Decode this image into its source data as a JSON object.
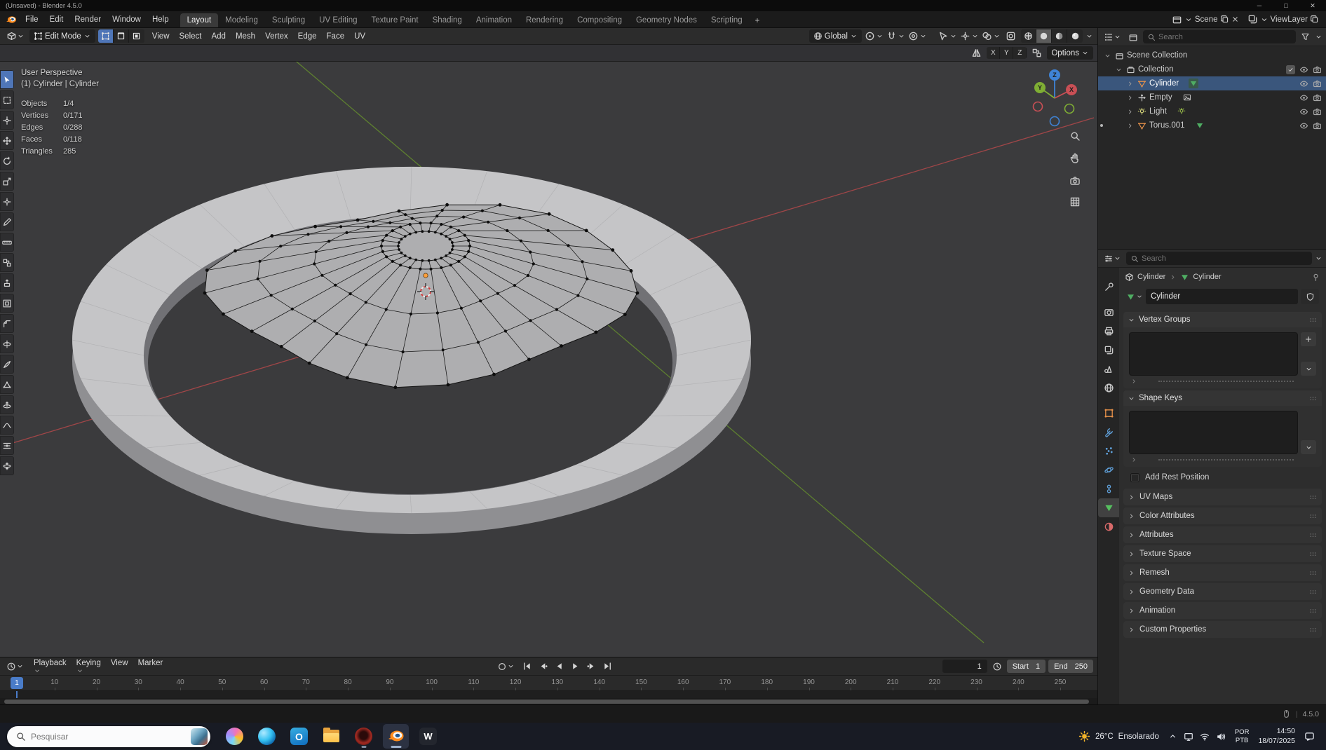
{
  "window": {
    "title": "(Unsaved) - Blender 4.5.0"
  },
  "topbar": {
    "menus": [
      "File",
      "Edit",
      "Render",
      "Window",
      "Help"
    ],
    "workspaces": [
      "Layout",
      "Modeling",
      "Sculpting",
      "UV Editing",
      "Texture Paint",
      "Shading",
      "Animation",
      "Rendering",
      "Compositing",
      "Geometry Nodes",
      "Scripting"
    ],
    "active_workspace": "Layout",
    "add_tab": "+",
    "scene_label": "Scene",
    "viewlayer_label": "ViewLayer"
  },
  "viewport_header": {
    "mode_label": "Edit Mode",
    "select_mode_icons": [
      "vertex",
      "edge",
      "face"
    ],
    "active_select_mode": "vertex",
    "menus": [
      "View",
      "Select",
      "Add",
      "Mesh",
      "Vertex",
      "Edge",
      "Face",
      "UV"
    ],
    "orientation_label": "Global",
    "shading_modes": [
      "wireframe",
      "solid",
      "material",
      "rendered"
    ],
    "active_shading_mode": "solid",
    "mirror_axes": [
      "X",
      "Y",
      "Z"
    ],
    "options_label": "Options"
  },
  "viewport": {
    "view_label": "User Perspective",
    "context_label": "(1) Cylinder | Cylinder",
    "stats": [
      {
        "label": "Objects",
        "value": "1/4"
      },
      {
        "label": "Vertices",
        "value": "0/171"
      },
      {
        "label": "Edges",
        "value": "0/288"
      },
      {
        "label": "Faces",
        "value": "0/118"
      },
      {
        "label": "Triangles",
        "value": "285"
      }
    ],
    "gizmo_axes": [
      "Z",
      "Y",
      "X"
    ],
    "nav_icons": [
      "zoom",
      "pan-hand",
      "camera-view",
      "toggle-ortho"
    ],
    "tools": [
      "tweak",
      "select-box",
      "cursor",
      "move",
      "rotate",
      "scale",
      "transform",
      "annotate",
      "measure",
      "add-primitive",
      "extrude-region",
      "inset-faces",
      "bevel",
      "loop-cut",
      "knife",
      "poly-build",
      "spin",
      "smooth",
      "edge-slide",
      "shrink-fatten"
    ]
  },
  "timeline": {
    "menus": [
      "Playback",
      "Keying",
      "View",
      "Marker"
    ],
    "playback_icons": [
      "jump-to-start",
      "jump-to-prev-keyframe",
      "play-reverse",
      "play",
      "jump-to-next-keyframe",
      "jump-to-end"
    ],
    "current_frame": "1",
    "start_label": "Start",
    "start_value": "1",
    "end_label": "End",
    "end_value": "250",
    "frame_labels": [
      10,
      20,
      30,
      40,
      50,
      60,
      70,
      80,
      90,
      100,
      110,
      120,
      130,
      140,
      150,
      160,
      170,
      180,
      190,
      200,
      210,
      220,
      230,
      240,
      250
    ]
  },
  "outliner": {
    "search_placeholder": "Search",
    "tree": [
      {
        "label": "Scene Collection",
        "icon": "scene-collection",
        "indent": 0,
        "expander": true,
        "expanded": true
      },
      {
        "label": "Collection",
        "icon": "collection",
        "indent": 1,
        "expander": true,
        "expanded": true,
        "controls": [
          "checkbox",
          "eye",
          "camera"
        ]
      },
      {
        "label": "Cylinder",
        "icon": "mesh-object",
        "indent": 2,
        "expander": true,
        "expanded": false,
        "selected": true,
        "data_icon": "mesh-data",
        "data_icon_active": true,
        "controls": [
          "eye",
          "camera"
        ]
      },
      {
        "label": "Empty",
        "icon": "empty-object",
        "indent": 2,
        "expander": true,
        "expanded": false,
        "data_icon": "image-data",
        "controls": [
          "eye",
          "camera"
        ]
      },
      {
        "label": "Light",
        "icon": "light-object",
        "indent": 2,
        "expander": true,
        "expanded": false,
        "data_icon": "light-data",
        "controls": [
          "eye",
          "camera"
        ]
      },
      {
        "label": "Torus.001",
        "icon": "mesh-object",
        "indent": 2,
        "expander": true,
        "expanded": false,
        "dot": true,
        "data_icon": "mesh-data",
        "controls": [
          "eye",
          "camera"
        ]
      }
    ]
  },
  "properties": {
    "search_placeholder": "Search",
    "breadcrumb": [
      {
        "icon": "object",
        "label": "Cylinder"
      },
      {
        "icon": "mesh-data",
        "label": "Cylinder"
      }
    ],
    "name_value": "Cylinder",
    "tabs": [
      {
        "name": "tool",
        "group": 0
      },
      {
        "name": "render",
        "group": 1
      },
      {
        "name": "output",
        "group": 1
      },
      {
        "name": "view-layer",
        "group": 1
      },
      {
        "name": "scene",
        "group": 1
      },
      {
        "name": "world",
        "group": 1
      },
      {
        "name": "object",
        "group": 2
      },
      {
        "name": "modifiers",
        "group": 2
      },
      {
        "name": "particles",
        "group": 2
      },
      {
        "name": "physics",
        "group": 2
      },
      {
        "name": "constraints",
        "group": 2
      },
      {
        "name": "object-data",
        "group": 2,
        "active": true
      },
      {
        "name": "material",
        "group": 2
      }
    ],
    "panels": [
      {
        "label": "Vertex Groups",
        "type": "list",
        "add_button": true
      },
      {
        "label": "Shape Keys",
        "type": "list",
        "add_button": false
      },
      {
        "label": "Add Rest Position",
        "type": "checkbox",
        "checked": false
      },
      {
        "label": "UV Maps",
        "type": "collapsed"
      },
      {
        "label": "Color Attributes",
        "type": "collapsed"
      },
      {
        "label": "Attributes",
        "type": "collapsed"
      },
      {
        "label": "Texture Space",
        "type": "collapsed"
      },
      {
        "label": "Remesh",
        "type": "collapsed"
      },
      {
        "label": "Geometry Data",
        "type": "collapsed"
      },
      {
        "label": "Animation",
        "type": "collapsed"
      },
      {
        "label": "Custom Properties",
        "type": "collapsed"
      }
    ]
  },
  "statusbar": {
    "version": "4.5.0"
  },
  "taskbar": {
    "search_placeholder": "Pesquisar",
    "apps": [
      {
        "name": "copilot"
      },
      {
        "name": "edge"
      },
      {
        "name": "outlook"
      },
      {
        "name": "file-explorer"
      },
      {
        "name": "media-app",
        "indicator": true
      },
      {
        "name": "blender",
        "indicator": true,
        "active": true
      },
      {
        "name": "office-w"
      }
    ],
    "weather_temp": "26°C",
    "weather_condition": "Ensolarado",
    "tray_icons": [
      "hidden-icons",
      "monitor",
      "wifi",
      "volume"
    ],
    "language_primary": "POR",
    "language_secondary": "PTB",
    "time": "14:50",
    "date": "18/07/2025",
    "notifications_icon": "chat"
  },
  "colors": {
    "accent_blue": "#4772b3",
    "object_orange": "#e8924a",
    "data_green": "#4fae63",
    "axis_x_red": "#a04648",
    "axis_y_green": "#5e8030",
    "selection_row_blue": "#3a567c"
  }
}
